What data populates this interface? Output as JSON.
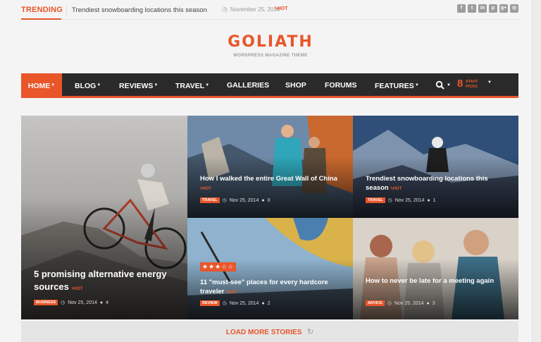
{
  "trending": {
    "label": "TRENDING",
    "title": "Trendiest snowboarding locations this season",
    "date": "November 25, 2014",
    "hot": "HOT"
  },
  "social_icons": [
    "facebook-icon",
    "twitter-icon",
    "linkedin-icon",
    "pinterest-icon",
    "googleplus-icon",
    "rss-icon"
  ],
  "logo": {
    "text": "GOLIATH",
    "tagline": "WORDPRESS MAGAZINE THEME"
  },
  "nav": {
    "items": [
      {
        "label": "HOME",
        "dropdown": true
      },
      {
        "label": "BLOG",
        "dropdown": true
      },
      {
        "label": "REVIEWS",
        "dropdown": true
      },
      {
        "label": "TRAVEL",
        "dropdown": true
      },
      {
        "label": "GALLERIES",
        "dropdown": false
      },
      {
        "label": "SHOP",
        "dropdown": false
      },
      {
        "label": "FORUMS",
        "dropdown": false
      },
      {
        "label": "FEATURES",
        "dropdown": true
      }
    ],
    "picks_count": "8",
    "picks_line1": "STAFF",
    "picks_line2": "PICKS"
  },
  "posts": [
    {
      "title": "5 promising alternative energy sources",
      "hot": "HOT",
      "category": "BUSINESS",
      "date": "Nov 25, 2014",
      "comments": "4"
    },
    {
      "title": "How I walked the entire Great Wall of China",
      "hot": "HOT",
      "category": "TRAVEL",
      "date": "Nov 25, 2014",
      "comments": "0"
    },
    {
      "title": "Trendiest snowboarding locations this season",
      "hot": "HOT",
      "category": "TRAVEL",
      "date": "Nov 25, 2014",
      "comments": "1"
    },
    {
      "title": "11 \"must-see\" places for every hardcore traveler",
      "hot": "HOT",
      "category": "REVIEW",
      "date": "Nov 25, 2014",
      "comments": "2",
      "rating": 3
    },
    {
      "title": "How to never be late for a meeting again",
      "category": "ADVICE",
      "date": "Nov 25, 2014",
      "comments": "3"
    }
  ],
  "load_more": "LOAD MORE STORIES",
  "colors": {
    "accent": "#e8562a",
    "nav_bg": "#2a2a2a"
  }
}
